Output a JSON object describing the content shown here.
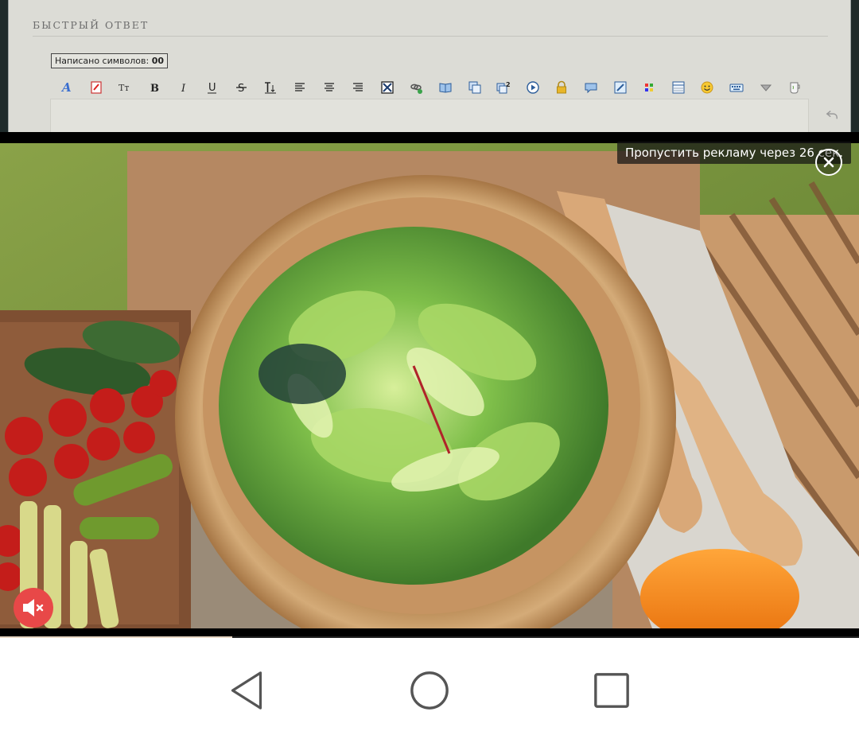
{
  "forum": {
    "quick_reply_title": "БЫСТРЫЙ ОТВЕТ",
    "char_counter_label": "Написано символов:",
    "char_counter_value": "00",
    "toolbar": [
      {
        "name": "font-icon",
        "glyph": "A"
      },
      {
        "name": "color-icon",
        "glyph": ""
      },
      {
        "name": "font-size-icon",
        "glyph": "Tт"
      },
      {
        "name": "bold-icon",
        "glyph": "B"
      },
      {
        "name": "italic-icon",
        "glyph": "I"
      },
      {
        "name": "underline-icon",
        "glyph": "U"
      },
      {
        "name": "strikethrough-icon",
        "glyph": "S"
      },
      {
        "name": "line-height-icon",
        "glyph": "↕T"
      },
      {
        "name": "align-left-icon",
        "glyph": ""
      },
      {
        "name": "align-center-icon",
        "glyph": ""
      },
      {
        "name": "align-right-icon",
        "glyph": ""
      },
      {
        "name": "image-icon",
        "glyph": ""
      },
      {
        "name": "link-icon",
        "glyph": ""
      },
      {
        "name": "book-icon",
        "glyph": ""
      },
      {
        "name": "quote-icon",
        "glyph": ""
      },
      {
        "name": "quote-2-icon",
        "glyph": "2"
      },
      {
        "name": "video-icon",
        "glyph": ""
      },
      {
        "name": "lock-icon",
        "glyph": ""
      },
      {
        "name": "speech-icon",
        "glyph": ""
      },
      {
        "name": "edit-icon",
        "glyph": ""
      },
      {
        "name": "palette-icon",
        "glyph": ""
      },
      {
        "name": "table-icon",
        "glyph": ""
      },
      {
        "name": "smiley-icon",
        "glyph": ""
      },
      {
        "name": "keyboard-icon",
        "glyph": ""
      },
      {
        "name": "spoiler-icon",
        "glyph": ""
      },
      {
        "name": "cup-icon",
        "glyph": ""
      }
    ]
  },
  "ad": {
    "skip_text": "Пропустить рекламу через 26 сек.",
    "progress_fraction": 0.27
  },
  "colors": {
    "mute_button": "#e84848",
    "progress_fill": "#e8d7c4"
  }
}
